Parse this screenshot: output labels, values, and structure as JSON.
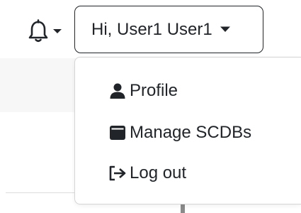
{
  "navbar": {
    "notifications": {
      "icon": "bell-icon",
      "caret_icon": "caret-down-icon"
    },
    "user_menu": {
      "button_label": "Hi, User1 User1",
      "caret_icon": "caret-down-icon",
      "items": [
        {
          "label": "Profile",
          "icon": "user-icon"
        },
        {
          "label": "Manage SCDBs",
          "icon": "database-icon"
        },
        {
          "label": "Log out",
          "icon": "logout-icon"
        }
      ]
    }
  },
  "colors": {
    "text": "#212529",
    "border": "#212529",
    "menu_border": "#d5d5d5",
    "page_band": "#f7f7f7"
  }
}
